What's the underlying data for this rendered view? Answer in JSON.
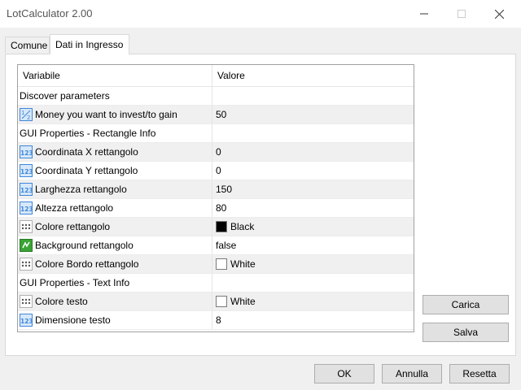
{
  "window": {
    "title": "LotCalculator 2.00"
  },
  "tabs": [
    {
      "label": "Comune",
      "active": false
    },
    {
      "label": "Dati in Ingresso",
      "active": true
    }
  ],
  "grid": {
    "columns": [
      "Variabile",
      "Valore"
    ],
    "rows": [
      {
        "type": "section",
        "variable": "Discover parameters",
        "value": ""
      },
      {
        "type": "double",
        "icon": "fraction-icon",
        "variable": "Money you want to invest/to gain",
        "value": "50"
      },
      {
        "type": "section",
        "variable": "GUI Properties - Rectangle Info",
        "value": ""
      },
      {
        "type": "int",
        "icon": "integer-icon",
        "variable": "Coordinata X rettangolo",
        "value": "0"
      },
      {
        "type": "int",
        "icon": "integer-icon",
        "variable": "Coordinata Y rettangolo",
        "value": "0"
      },
      {
        "type": "int",
        "icon": "integer-icon",
        "variable": "Larghezza rettangolo",
        "value": "150"
      },
      {
        "type": "int",
        "icon": "integer-icon",
        "variable": "Altezza rettangolo",
        "value": "80"
      },
      {
        "type": "color",
        "icon": "color-icon",
        "variable": "Colore rettangolo",
        "value": "Black",
        "swatch": "#000000"
      },
      {
        "type": "bool",
        "icon": "boolean-icon",
        "variable": "Background rettangolo",
        "value": "false"
      },
      {
        "type": "color",
        "icon": "color-icon",
        "variable": "Colore Bordo rettangolo",
        "value": "White",
        "swatch": "#ffffff"
      },
      {
        "type": "section",
        "variable": "GUI Properties - Text Info",
        "value": ""
      },
      {
        "type": "color",
        "icon": "color-icon",
        "variable": "Colore testo",
        "value": "White",
        "swatch": "#ffffff"
      },
      {
        "type": "int",
        "icon": "integer-icon",
        "variable": "Dimensione testo",
        "value": "8"
      }
    ]
  },
  "side_buttons": {
    "load": "Carica",
    "save": "Salva"
  },
  "footer": {
    "ok": "OK",
    "cancel": "Annulla",
    "reset": "Resetta"
  },
  "colors": {
    "alt_row": "#f0f0f0",
    "icon_blue": "#3f87d8",
    "icon_green": "#3aa335"
  }
}
